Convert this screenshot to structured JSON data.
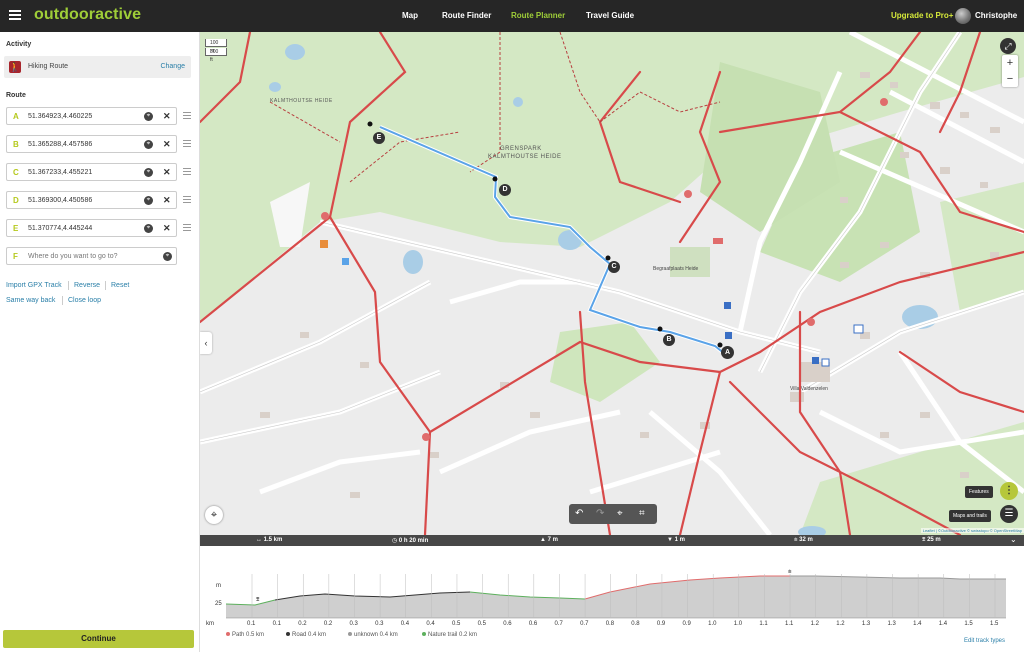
{
  "app": {
    "logo": "outdooractive"
  },
  "nav": [
    {
      "label": "Map"
    },
    {
      "label": "Route Finder"
    },
    {
      "label": "Route Planner"
    },
    {
      "label": "Travel Guide"
    }
  ],
  "header": {
    "upgrade": "Upgrade to Pro+",
    "user": "Christophe"
  },
  "sidebar": {
    "activity_title": "Activity",
    "activity": "Hiking Route",
    "change": "Change",
    "route_title": "Route",
    "waypoints": [
      {
        "letter": "A",
        "value": "51.364923,4.460225"
      },
      {
        "letter": "B",
        "value": "51.365288,4.457586"
      },
      {
        "letter": "C",
        "value": "51.367233,4.455221"
      },
      {
        "letter": "D",
        "value": "51.369300,4.450586"
      },
      {
        "letter": "E",
        "value": "51.370774,4.445244"
      }
    ],
    "next": {
      "letter": "F",
      "placeholder": "Where do you want to go to?"
    },
    "links": [
      "Import GPX Track",
      "Reverse",
      "Reset",
      "Same way back",
      "Close loop"
    ],
    "continue": "Continue"
  },
  "map": {
    "scale": [
      "100 m",
      "300 ft"
    ],
    "park_label_1": "GRENSPARK",
    "park_label_2": "KALMTHOUTSE HEIDE",
    "heide_label": "KALMTHOUTSE HEIDE",
    "place_label": "Villa Valdenzelen",
    "begraaf": "Begraafplaats Heide",
    "markers": [
      "A",
      "B",
      "C",
      "D",
      "E"
    ],
    "features_tip": "Features",
    "maps_tip": "Maps and trails",
    "attribution": "Leaflet | ©Outdooractive © swisstopo © OpenStreetMap"
  },
  "stats": {
    "distance": "1.5 km",
    "duration": "0 h 20 min",
    "ascent": "7 m",
    "descent": "1 m",
    "max_alt": "32 m",
    "min_alt": "25 m"
  },
  "elevation": {
    "y_unit": "m",
    "y_tick": "25",
    "x_unit": "km",
    "x_ticks": [
      "0.1",
      "0.1",
      "0.2",
      "0.2",
      "0.3",
      "0.3",
      "0.4",
      "0.4",
      "0.5",
      "0.5",
      "0.6",
      "0.6",
      "0.7",
      "0.7",
      "0.8",
      "0.8",
      "0.9",
      "0.9",
      "1.0",
      "1.0",
      "1.1",
      "1.1",
      "1.2",
      "1.2",
      "1.3",
      "1.3",
      "1.4",
      "1.4",
      "1.5",
      "1.5"
    ],
    "legend": [
      {
        "label": "Path 0.5 km",
        "color": "#e06c6c"
      },
      {
        "label": "Road 0.4 km",
        "color": "#333333"
      },
      {
        "label": "unknown 0.4 km",
        "color": "#999999"
      },
      {
        "label": "Nature trail 0.2 km",
        "color": "#5db05d"
      }
    ],
    "edit": "Edit track types"
  },
  "colors": {
    "accent": "#9fce38",
    "button": "#b6c73a",
    "route": "#5aa3e8"
  }
}
